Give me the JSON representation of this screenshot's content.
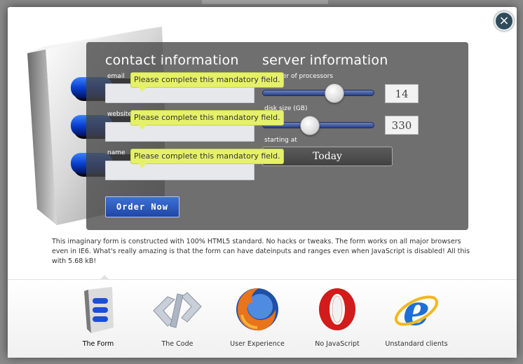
{
  "modal": {
    "close_symbol": "×"
  },
  "form": {
    "contact_heading": "contact information",
    "server_heading": "server information",
    "fields": [
      {
        "label": "email",
        "value": "",
        "tooltip": "Please complete this mandatory field."
      },
      {
        "label": "website",
        "value": "",
        "tooltip": "Please complete this mandatory field."
      },
      {
        "label": "name",
        "value": "",
        "tooltip": "Please complete this mandatory field."
      }
    ],
    "processors": {
      "label": "number of processors",
      "value": "14"
    },
    "disk": {
      "label": "disk size (GB)",
      "value": "330"
    },
    "starting": {
      "label": "starting at",
      "value": "Today"
    },
    "order_button": "Order Now"
  },
  "description": "This imaginary form is constructed with 100% HTML5 standard. No hacks or tweaks. The form works on all major browsers even in IE6. What's really amazing is that the form can have dateinputs and ranges even when JavaScript is disabled! All this with 5.68 kB!",
  "tabs": [
    {
      "label": "The Form",
      "icon": "form-icon",
      "active": true
    },
    {
      "label": "The Code",
      "icon": "code-icon",
      "active": false
    },
    {
      "label": "User Experience",
      "icon": "firefox-icon",
      "active": false
    },
    {
      "label": "No JavaScript",
      "icon": "opera-icon",
      "active": false
    },
    {
      "label": "Unstandard clients",
      "icon": "internet-explorer-icon",
      "active": false
    }
  ],
  "colors": {
    "accent": "#2a52be",
    "tooltip": "#e6f16a",
    "panel": "#464646"
  }
}
